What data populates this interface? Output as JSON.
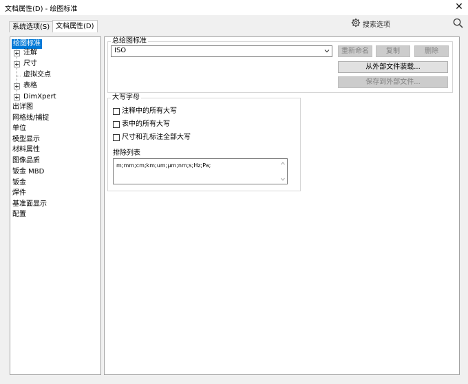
{
  "window": {
    "title": "文档属性(D) - 绘图标准",
    "close_label": "✕"
  },
  "tabs": [
    {
      "label": "系统选项(S)"
    },
    {
      "label": "文档属性(D)"
    }
  ],
  "search": {
    "placeholder": "搜索选项"
  },
  "tree": {
    "items": [
      {
        "label": "绘图标准"
      },
      {
        "label": "注解"
      },
      {
        "label": "尺寸"
      },
      {
        "label": "虚拟交点"
      },
      {
        "label": "表格"
      },
      {
        "label": "DimXpert"
      },
      {
        "label": "出详图"
      },
      {
        "label": "网格线/捕捉"
      },
      {
        "label": "单位"
      },
      {
        "label": "模型显示"
      },
      {
        "label": "材料属性"
      },
      {
        "label": "图像品质"
      },
      {
        "label": "钣金 MBD"
      },
      {
        "label": "钣金"
      },
      {
        "label": "焊件"
      },
      {
        "label": "基准面显示"
      },
      {
        "label": "配置"
      }
    ]
  },
  "standard_group": {
    "title": "总绘图标准",
    "selected_standard": "ISO",
    "rename_label": "重新命名",
    "copy_label": "复制",
    "delete_label": "删除",
    "load_label": "从外部文件装载...",
    "save_label": "保存到外部文件..."
  },
  "caps_group": {
    "title": "大写字母",
    "options": [
      {
        "label": "注释中的所有大写",
        "checked": false
      },
      {
        "label": "表中的所有大写",
        "checked": false
      },
      {
        "label": "尺寸和孔标注全部大写",
        "checked": false
      }
    ],
    "exclusion_label": "排除列表",
    "exclusion_value": "m;mm;cm;km;um;μm;nm;s;Hz;Pa;"
  },
  "colors": {
    "selection": "#0078d7",
    "window_bg": "#f0f0f0"
  }
}
